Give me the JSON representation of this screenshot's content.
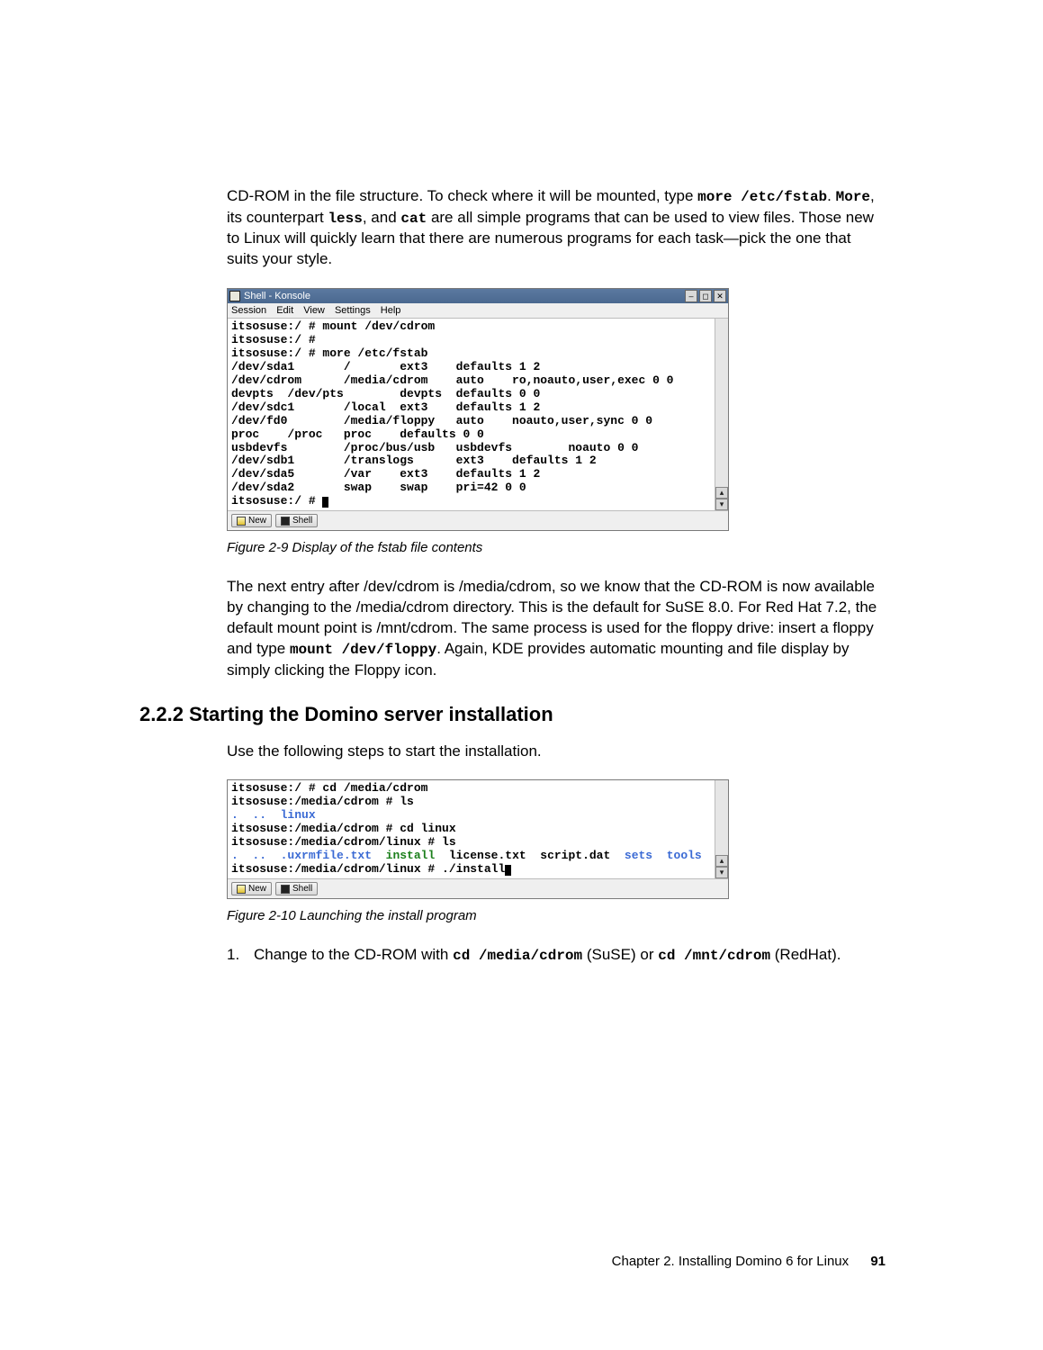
{
  "intro": {
    "line1a": "CD-ROM in the file structure. To check where it will be mounted, type ",
    "cmd1": "more /etc/fstab",
    "line1b": ". ",
    "more": "More",
    "line1c": ", its counterpart ",
    "less": "less",
    "line1d": ", and ",
    "cat": "cat",
    "line1e": " are all simple programs that can be used to view files. Those new to Linux will quickly learn that there are numerous programs for each task—pick the one that suits your style."
  },
  "konsole1": {
    "title": "Shell - Konsole",
    "menu": [
      "Session",
      "Edit",
      "View",
      "Settings",
      "Help"
    ],
    "winbtns": [
      "–",
      "◻",
      "✕"
    ],
    "lines": [
      "itsosuse:/ # mount /dev/cdrom",
      "itsosuse:/ #",
      "itsosuse:/ # more /etc/fstab",
      "/dev/sda1       /       ext3    defaults 1 2",
      "/dev/cdrom      /media/cdrom    auto    ro,noauto,user,exec 0 0",
      "devpts  /dev/pts        devpts  defaults 0 0",
      "/dev/sdc1       /local  ext3    defaults 1 2",
      "/dev/fd0        /media/floppy   auto    noauto,user,sync 0 0",
      "proc    /proc   proc    defaults 0 0",
      "usbdevfs        /proc/bus/usb   usbdevfs        noauto 0 0",
      "/dev/sdb1       /translogs      ext3    defaults 1 2",
      "/dev/sda5       /var    ext3    defaults 1 2",
      "/dev/sda2       swap    swap    pri=42 0 0",
      "itsosuse:/ # "
    ],
    "tabs": {
      "new": "New",
      "shell": "Shell"
    }
  },
  "fig29": "Figure 2-9   Display of the fstab file contents",
  "para2": {
    "a": "The next entry after /dev/cdrom is /media/cdrom, so we know that the CD-ROM is now available by changing to the /media/cdrom directory. This is the default for SuSE 8.0. For Red Hat 7.2, the default mount point is /mnt/cdrom. The same process is used for the floppy drive: insert a floppy and type ",
    "cmd": "mount /dev/floppy",
    "b": ". Again, KDE provides automatic mounting and file display by simply clicking the Floppy icon."
  },
  "sec222": "2.2.2  Starting the Domino server installation",
  "sec222_intro": "Use the following steps to start the installation.",
  "konsole2": {
    "plain_lines": [
      "itsosuse:/ # cd /media/cdrom",
      "itsosuse:/media/cdrom # ls"
    ],
    "ls1_dots": ".  ..  ",
    "ls1_dir": "linux",
    "line_cd": "itsosuse:/media/cdrom # cd linux",
    "line_ls2": "itsosuse:/media/cdrom/linux # ls",
    "ls2_a": ".  ..  .uxrmfile.txt  ",
    "ls2_install": "install",
    "ls2_b": "  license.txt  script.dat  ",
    "ls2_sets": "sets",
    "ls2_c": "  ",
    "ls2_tools": "tools",
    "line_run": "itsosuse:/media/cdrom/linux # ./install",
    "tabs": {
      "new": "New",
      "shell": "Shell"
    }
  },
  "fig210": "Figure 2-10   Launching the install program",
  "step1": {
    "num": "1.",
    "a": "Change to the CD-ROM with ",
    "cmd1": "cd /media/cdrom",
    "b": " (SuSE) or ",
    "cmd2": "cd /mnt/cdrom",
    "c": " (RedHat)."
  },
  "footer": {
    "chapter": "Chapter 2. Installing Domino 6 for Linux",
    "page": "91"
  }
}
